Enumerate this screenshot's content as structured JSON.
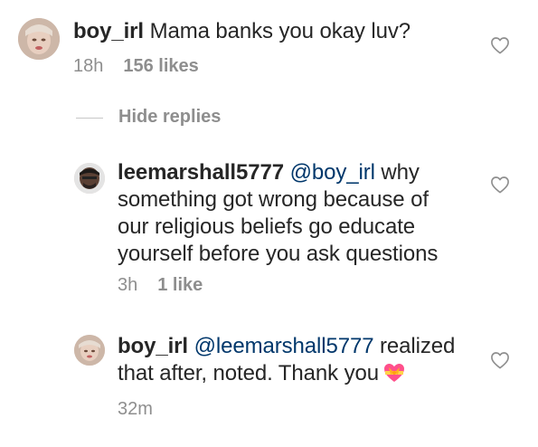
{
  "comments": [
    {
      "username": "boy_irl",
      "text": " Mama banks you okay luv?",
      "time": "18h",
      "likes": "156 likes",
      "avatar_icon": "avatar-photo",
      "like_icon": "heart-outline-icon"
    },
    {
      "username": "leemarshall5777",
      "mention": "@boy_irl",
      "line1_rest": " why",
      "lines": [
        "something got wrong because of",
        "our religious beliefs go educate",
        "yourself before you ask questions"
      ],
      "time": "3h",
      "likes": "1 like",
      "avatar_icon": "avatar-photo",
      "like_icon": "heart-outline-icon"
    },
    {
      "username": "boy_irl",
      "mention": "@leemarshall5777",
      "line1_rest": " realized",
      "line2": "that after, noted. Thank you",
      "emoji": "heart-with-ribbon-emoji",
      "time": "32m",
      "avatar_icon": "avatar-photo",
      "like_icon": "heart-outline-icon"
    }
  ],
  "replies_toggle": {
    "label": "Hide replies"
  },
  "colors": {
    "text": "#262626",
    "secondary": "#8e8e8e",
    "mention": "#00376b",
    "divider": "#c7c7c7"
  }
}
